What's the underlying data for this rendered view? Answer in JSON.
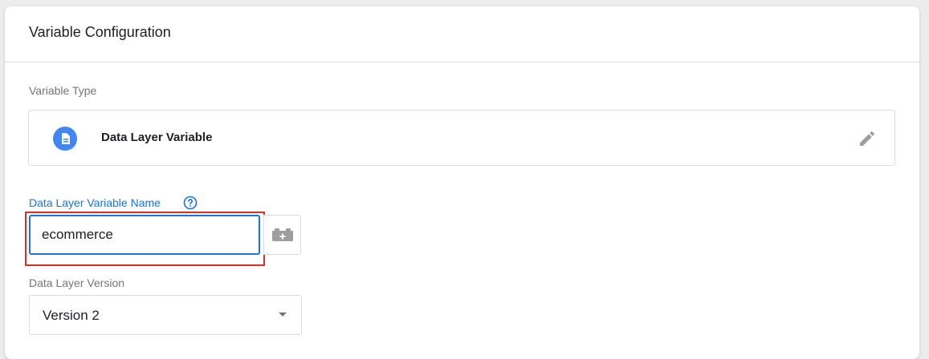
{
  "card": {
    "title": "Variable Configuration"
  },
  "variable_type": {
    "label": "Variable Type",
    "name": "Data Layer Variable",
    "icon": "document-icon",
    "icon_color": "#4285f4"
  },
  "variable_name": {
    "label": "Data Layer Variable Name",
    "value": "ecommerce",
    "help_icon": "help-circle-icon",
    "picker_icon": "variable-brick-icon"
  },
  "version": {
    "label": "Data Layer Version",
    "selected": "Version 2"
  },
  "colors": {
    "accent": "#1a73e8",
    "highlight": "#d93025"
  }
}
